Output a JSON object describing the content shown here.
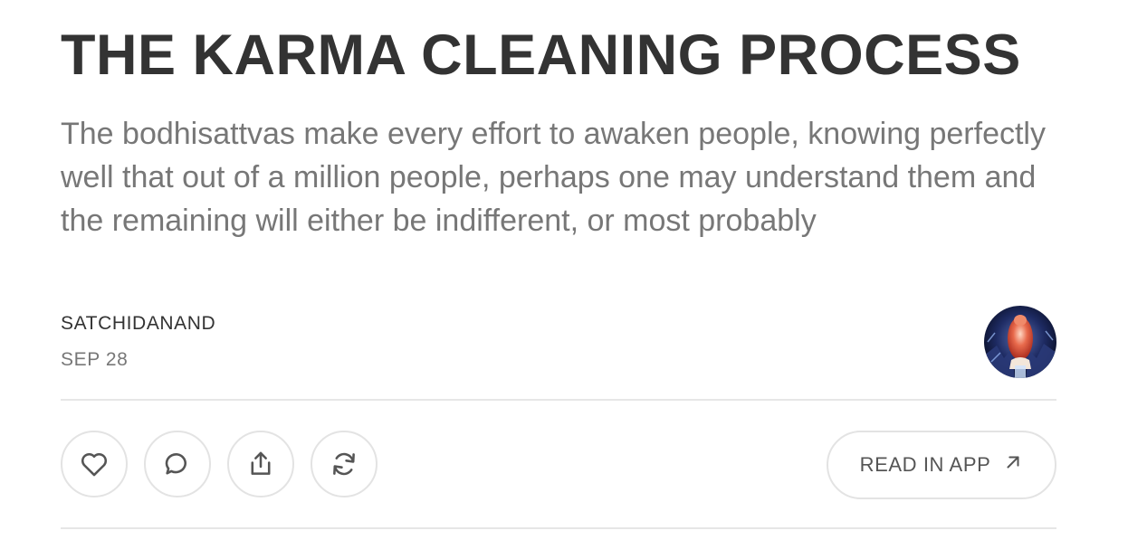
{
  "post": {
    "title": "THE KARMA CLEANING PROCESS",
    "subtitle": "The bodhisattvas make every effort to awaken people, knowing perfectly well that out of a million people, perhaps one may understand them and the remaining will either be indifferent, or most probably",
    "author": "SATCHIDANAND",
    "date": "SEP 28"
  },
  "actions": {
    "icons": [
      "heart-icon",
      "comment-icon",
      "share-icon",
      "restack-icon"
    ],
    "read_in_app_label": "READ IN APP",
    "read_in_app_icon": "arrow-up-right-icon"
  },
  "colors": {
    "title": "#333333",
    "subtitle": "#777777",
    "divider": "#e6e6e6",
    "button_border": "#e3e3e3"
  }
}
